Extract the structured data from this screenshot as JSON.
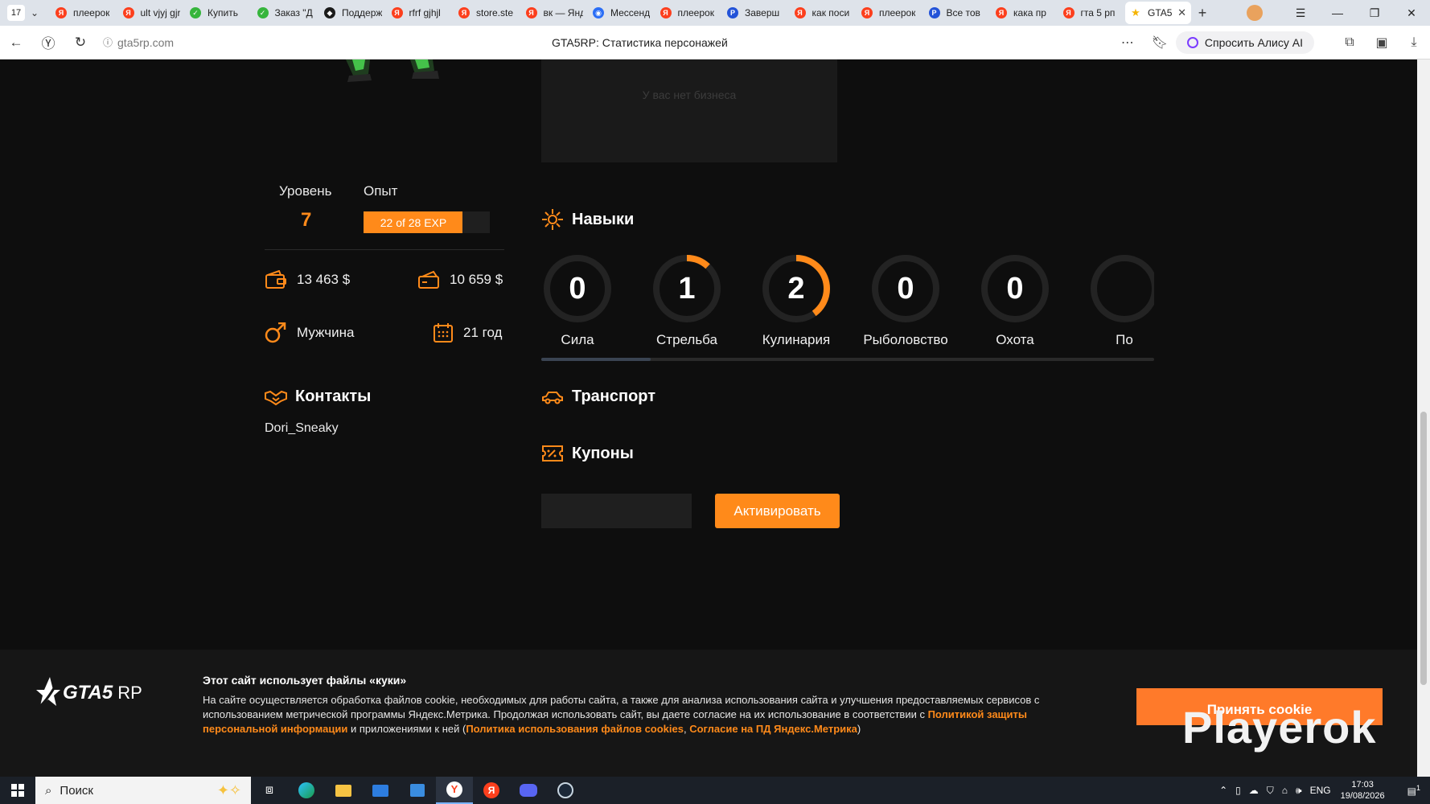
{
  "browser": {
    "tab_count": "17",
    "tabs": [
      {
        "label": "плеерок",
        "fav": "Я",
        "color": "#fc3f1d"
      },
      {
        "label": "ult vjyj gjrehfnm",
        "fav": "Я",
        "color": "#fc3f1d"
      },
      {
        "label": "Купить",
        "fav": "✓",
        "color": "#36b53c"
      },
      {
        "label": "Заказ \"Д",
        "fav": "✓",
        "color": "#36b53c"
      },
      {
        "label": "Поддерж",
        "fav": "◆",
        "color": "#1a1a1a"
      },
      {
        "label": "rfrf gjhjl",
        "fav": "Я",
        "color": "#fc3f1d"
      },
      {
        "label": "store.ste",
        "fav": "Я",
        "color": "#fc3f1d"
      },
      {
        "label": "вк — Янд",
        "fav": "Я",
        "color": "#fc3f1d"
      },
      {
        "label": "Мессенд",
        "fav": "◉",
        "color": "#2b6ef6"
      },
      {
        "label": "плеерок",
        "fav": "Я",
        "color": "#fc3f1d"
      },
      {
        "label": "Заверш",
        "fav": "P",
        "color": "#2353d8"
      },
      {
        "label": "как поси",
        "fav": "Я",
        "color": "#fc3f1d"
      },
      {
        "label": "плеерок",
        "fav": "Я",
        "color": "#fc3f1d"
      },
      {
        "label": "Все тов",
        "fav": "P",
        "color": "#2353d8"
      },
      {
        "label": "кака пр",
        "fav": "Я",
        "color": "#fc3f1d"
      },
      {
        "label": "гта 5 рп",
        "fav": "Я",
        "color": "#fc3f1d"
      }
    ],
    "active_tab": {
      "label": "GTA5",
      "fav": "★",
      "color": "#f5b400"
    },
    "url": "gta5rp.com",
    "page_title": "GTA5RP: Статистика персонажей",
    "alice_label": "Спросить Алису AI"
  },
  "business": {
    "empty_text": "У вас нет бизнеса"
  },
  "profile": {
    "level_label": "Уровень",
    "level_value": "7",
    "exp_label": "Опыт",
    "exp_text": "22 of 28 EXP",
    "exp_fraction": 0.786,
    "cash": "13 463 $",
    "bank": "10 659 $",
    "gender": "Мужчина",
    "age": "21 год"
  },
  "contacts": {
    "title": "Контакты",
    "items": [
      "Dori_Sneaky"
    ]
  },
  "skills": {
    "title": "Навыки",
    "items": [
      {
        "name": "Сила",
        "value": "0",
        "progress": 0
      },
      {
        "name": "Стрельба",
        "value": "1",
        "progress": 0.12
      },
      {
        "name": "Кулинария",
        "value": "2",
        "progress": 0.4
      },
      {
        "name": "Рыболовство",
        "value": "0",
        "progress": 0
      },
      {
        "name": "Охота",
        "value": "0",
        "progress": 0
      },
      {
        "name": "По",
        "value": "",
        "progress": 0
      }
    ]
  },
  "transport": {
    "title": "Транспорт"
  },
  "coupons": {
    "title": "Купоны",
    "input_value": "",
    "button": "Активировать"
  },
  "cookie": {
    "logo_text": "GTA5",
    "logo_suffix": "RP",
    "title": "Этот сайт использует файлы «куки»",
    "text_1": "На сайте осуществляется обработка файлов cookie, необходимых для работы сайта, а также для анализа использования сайта и улучшения предоставляемых сервисов с использованием метрической программы Яндекс.Метрика. Продолжая использовать сайт, вы даете согласие на их использование в соответствии с ",
    "link_1": "Политикой защиты персональной информации",
    "text_2": " и приложениями к ней (",
    "link_2": "Политика использования файлов cookies",
    "text_3": ", ",
    "link_3": "Согласие на ПД Яндекс.Метрика",
    "text_4": ")",
    "accept": "Принять cookie",
    "watermark": "Playerok"
  },
  "taskbar": {
    "search_placeholder": "Поиск",
    "lang": "ENG",
    "time": "17:03",
    "date": "19/08/2026",
    "notif_count": "1"
  },
  "colors": {
    "accent": "#ff8a1a",
    "bg": "#0e0e0e"
  }
}
